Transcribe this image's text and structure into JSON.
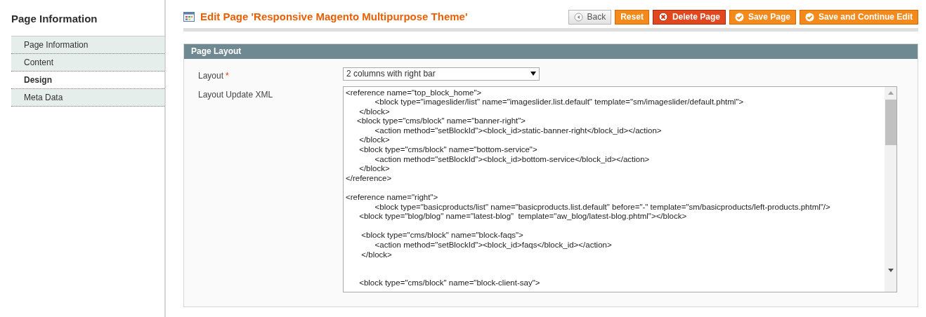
{
  "sidebar": {
    "title": "Page Information",
    "items": [
      {
        "label": "Page Information",
        "selected": false
      },
      {
        "label": "Content",
        "selected": false
      },
      {
        "label": "Design",
        "selected": true
      },
      {
        "label": "Meta Data",
        "selected": false
      }
    ]
  },
  "header": {
    "title": "Edit Page 'Responsive Magento Multipurpose Theme'",
    "buttons": [
      {
        "label": "Back",
        "kind": "back"
      },
      {
        "label": "Reset",
        "kind": "plain"
      },
      {
        "label": "Delete Page",
        "kind": "delete"
      },
      {
        "label": "Save Page",
        "kind": "save"
      },
      {
        "label": "Save and Continue Edit",
        "kind": "save"
      }
    ]
  },
  "section": {
    "title": "Page Layout",
    "fields": [
      {
        "label": "Layout",
        "required_mark": "*",
        "kind": "select",
        "value": "2 columns with right bar"
      },
      {
        "label": "Layout Update XML",
        "kind": "textarea",
        "value": "<reference name=\"top_block_home\">\n             <block type=\"imageslider/list\" name=\"imageslider.list.default\" template=\"sm/imageslider/default.phtml\">\n      </block>\n     <block type=\"cms/block\" name=\"banner-right\">\n             <action method=\"setBlockId\"><block_id>static-banner-right</block_id></action>\n      </block>\n      <block type=\"cms/block\" name=\"bottom-service\">\n             <action method=\"setBlockId\"><block_id>bottom-service</block_id></action>\n      </block>\n</reference>\n\n<reference name=\"right\">\n             <block type=\"basicproducts/list\" name=\"basicproducts.list.default\" before=\"-\" template=\"sm/basicproducts/left-products.phtml\"/>\n      <block type=\"blog/blog\" name=\"latest-blog\"  template=\"aw_blog/latest-blog.phtml\"></block>\n\n       <block type=\"cms/block\" name=\"block-faqs\">\n             <action method=\"setBlockId\"><block_id>faqs</block_id></action>\n       </block>\n\n\n      <block type=\"cms/block\" name=\"block-client-say\">"
      }
    ]
  }
}
